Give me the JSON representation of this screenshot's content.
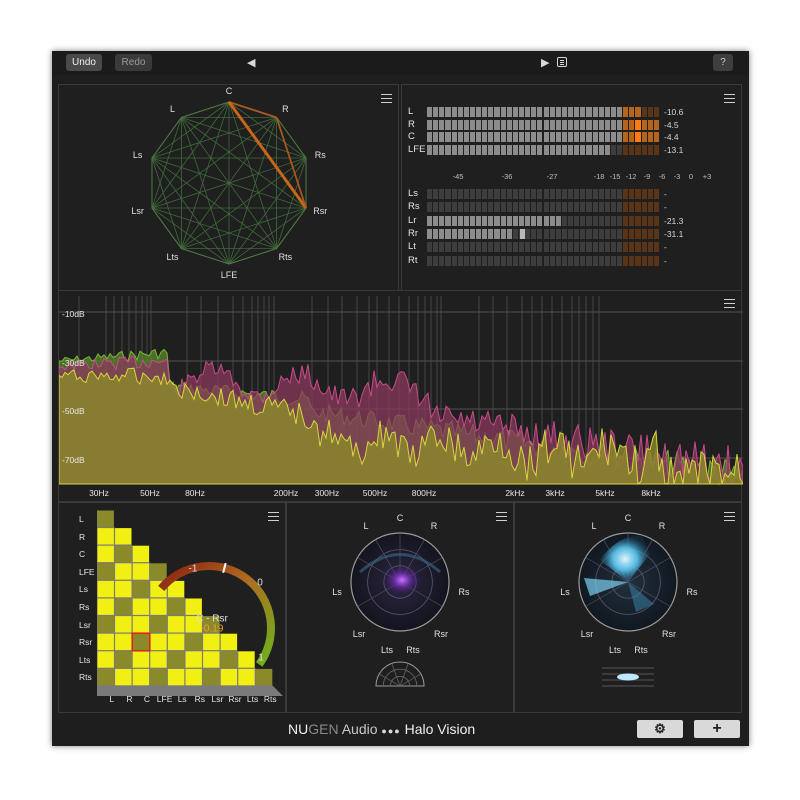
{
  "toolbar": {
    "undo": "Undo",
    "redo": "Redo",
    "help": "?",
    "prev_glyph": "◀",
    "play_glyph": "▶"
  },
  "surround_scope": {
    "labels": [
      "C",
      "R",
      "Rs",
      "Rsr",
      "Rts",
      "LFE",
      "Lts",
      "Lsr",
      "Ls",
      "L"
    ]
  },
  "level_meters": {
    "main": [
      {
        "label": "L",
        "value": "-10.6",
        "level": 0.92,
        "peak_orange": false
      },
      {
        "label": "R",
        "value": "-4.5",
        "level": 1.0,
        "peak_orange": true
      },
      {
        "label": "C",
        "value": "-4.4",
        "level": 1.0,
        "peak_orange": true
      },
      {
        "label": "LFE",
        "value": "-13.1",
        "level": 0.78,
        "peak_orange": false
      }
    ],
    "scale": [
      "-45",
      "-36",
      "-27",
      "-18",
      "-15",
      "-12",
      "-9",
      "-6",
      "-3",
      "0",
      "+3"
    ],
    "secondary": [
      {
        "label": "Ls",
        "value": "-",
        "level": 0
      },
      {
        "label": "Rs",
        "value": "-",
        "level": 0
      },
      {
        "label": "Lr",
        "value": "-21.3",
        "level": 0.57
      },
      {
        "label": "Rr",
        "value": "-31.1",
        "level": 0.36
      },
      {
        "label": "Lt",
        "value": "-",
        "level": 0
      },
      {
        "label": "Rt",
        "value": "-",
        "level": 0
      }
    ]
  },
  "spectrum": {
    "db_labels": [
      "-10dB",
      "-30dB",
      "-50dB",
      "-70dB"
    ],
    "hz_labels": [
      "30Hz",
      "50Hz",
      "80Hz",
      "200Hz",
      "300Hz",
      "500Hz",
      "800Hz",
      "2kHz",
      "3kHz",
      "5kHz",
      "8kHz"
    ]
  },
  "correlation": {
    "channels": [
      "L",
      "R",
      "C",
      "LFE",
      "Ls",
      "Rs",
      "Lsr",
      "Rsr",
      "Lts",
      "Rts"
    ],
    "scale_min": "-1",
    "scale_zero": "0",
    "scale_max": "1",
    "selected_pair": "C - Rsr",
    "selected_value": "-0.19",
    "colors": {
      "high": "#f2ef12",
      "low": "#8a8a2a",
      "marker": "#e02020"
    }
  },
  "vector_scope_1": {
    "labels": [
      "L",
      "C",
      "R",
      "Ls",
      "Rs",
      "Lsr",
      "Rsr"
    ],
    "height_labels": [
      "Lts",
      "Rts"
    ]
  },
  "vector_scope_2": {
    "labels": [
      "L",
      "C",
      "R",
      "Ls",
      "Rs",
      "Lsr",
      "Rsr"
    ],
    "height_labels": [
      "Lts",
      "Rts"
    ]
  },
  "footer": {
    "brand_nu": "NU",
    "brand_gen": "GEN",
    "brand_audio": " Audio ",
    "dots": "●●●",
    "product": " Halo Vision",
    "settings_icon": "⚙",
    "add_icon": "+"
  }
}
